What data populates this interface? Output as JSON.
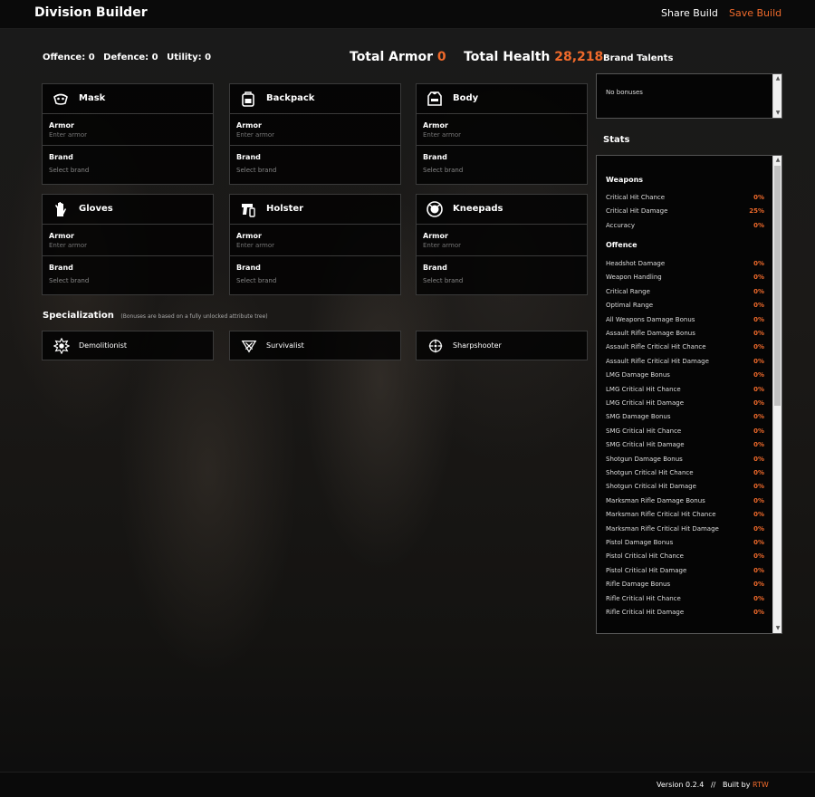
{
  "navbar": {
    "brand": "Division Builder",
    "share_label": "Share Build",
    "save_label": "Save Build"
  },
  "summary": {
    "offence": "Offence: 0",
    "defence": "Defence: 0",
    "utility": "Utility: 0",
    "armor_label": "Total Armor",
    "armor_value": "0",
    "health_label": "Total Health",
    "health_value": "28,218"
  },
  "gear": [
    {
      "name": "Mask",
      "icon": "mask-icon",
      "armor_label": "Armor",
      "armor_placeholder": "Enter armor",
      "brand_label": "Brand",
      "brand_placeholder": "Select brand"
    },
    {
      "name": "Backpack",
      "icon": "backpack-icon",
      "armor_label": "Armor",
      "armor_placeholder": "Enter armor",
      "brand_label": "Brand",
      "brand_placeholder": "Select brand"
    },
    {
      "name": "Body",
      "icon": "body-armor-icon",
      "armor_label": "Armor",
      "armor_placeholder": "Enter armor",
      "brand_label": "Brand",
      "brand_placeholder": "Select brand"
    },
    {
      "name": "Gloves",
      "icon": "gloves-icon",
      "armor_label": "Armor",
      "armor_placeholder": "Enter armor",
      "brand_label": "Brand",
      "brand_placeholder": "Select brand"
    },
    {
      "name": "Holster",
      "icon": "holster-icon",
      "armor_label": "Armor",
      "armor_placeholder": "Enter armor",
      "brand_label": "Brand",
      "brand_placeholder": "Select brand"
    },
    {
      "name": "Kneepads",
      "icon": "kneepads-icon",
      "armor_label": "Armor",
      "armor_placeholder": "Enter armor",
      "brand_label": "Brand",
      "brand_placeholder": "Select brand"
    }
  ],
  "specialization": {
    "title": "Specialization",
    "note": "(Bonuses are based on a fully unlocked attribute tree)",
    "items": [
      {
        "label": "Demolitionist",
        "icon": "demolitionist-icon"
      },
      {
        "label": "Survivalist",
        "icon": "survivalist-icon"
      },
      {
        "label": "Sharpshooter",
        "icon": "sharpshooter-icon"
      }
    ]
  },
  "brand_talents": {
    "title": "Brand Talents",
    "text": "No bonuses"
  },
  "stats": {
    "title": "Stats",
    "weapons_title": "Weapons",
    "weapons": [
      {
        "label": "Critical Hit Chance",
        "value": "0%"
      },
      {
        "label": "Critical Hit Damage",
        "value": "25%"
      },
      {
        "label": "Accuracy",
        "value": "0%"
      }
    ],
    "offence_title": "Offence",
    "offence": [
      {
        "label": "Headshot Damage",
        "value": "0%"
      },
      {
        "label": "Weapon Handling",
        "value": "0%"
      },
      {
        "label": "Critical Range",
        "value": "0%"
      },
      {
        "label": "Optimal Range",
        "value": "0%"
      },
      {
        "label": "All Weapons Damage Bonus",
        "value": "0%"
      },
      {
        "label": "Assault Rifle Damage Bonus",
        "value": "0%"
      },
      {
        "label": "Assault Rifle Critical Hit Chance",
        "value": "0%"
      },
      {
        "label": "Assault Rifle Critical Hit Damage",
        "value": "0%"
      },
      {
        "label": "LMG Damage Bonus",
        "value": "0%"
      },
      {
        "label": "LMG Critical Hit Chance",
        "value": "0%"
      },
      {
        "label": "LMG Critical Hit Damage",
        "value": "0%"
      },
      {
        "label": "SMG Damage Bonus",
        "value": "0%"
      },
      {
        "label": "SMG Critical Hit Chance",
        "value": "0%"
      },
      {
        "label": "SMG Critical Hit Damage",
        "value": "0%"
      },
      {
        "label": "Shotgun Damage Bonus",
        "value": "0%"
      },
      {
        "label": "Shotgun Critical Hit Chance",
        "value": "0%"
      },
      {
        "label": "Shotgun Critical Hit Damage",
        "value": "0%"
      },
      {
        "label": "Marksman Rifle Damage Bonus",
        "value": "0%"
      },
      {
        "label": "Marksman Rifle Critical Hit Chance",
        "value": "0%"
      },
      {
        "label": "Marksman Rifle Critical Hit Damage",
        "value": "0%"
      },
      {
        "label": "Pistol Damage Bonus",
        "value": "0%"
      },
      {
        "label": "Pistol Critical Hit Chance",
        "value": "0%"
      },
      {
        "label": "Pistol Critical Hit Damage",
        "value": "0%"
      },
      {
        "label": "Rifle Damage Bonus",
        "value": "0%"
      },
      {
        "label": "Rifle Critical Hit Chance",
        "value": "0%"
      },
      {
        "label": "Rifle Critical Hit Damage",
        "value": "0%"
      }
    ]
  },
  "footer": {
    "version": "Version 0.2.4",
    "separator": "//",
    "built_by": "Built by",
    "author": "RTW"
  },
  "colors": {
    "accent": "#f06a2b",
    "panel": "#000000",
    "border": "#3a3a3a"
  }
}
